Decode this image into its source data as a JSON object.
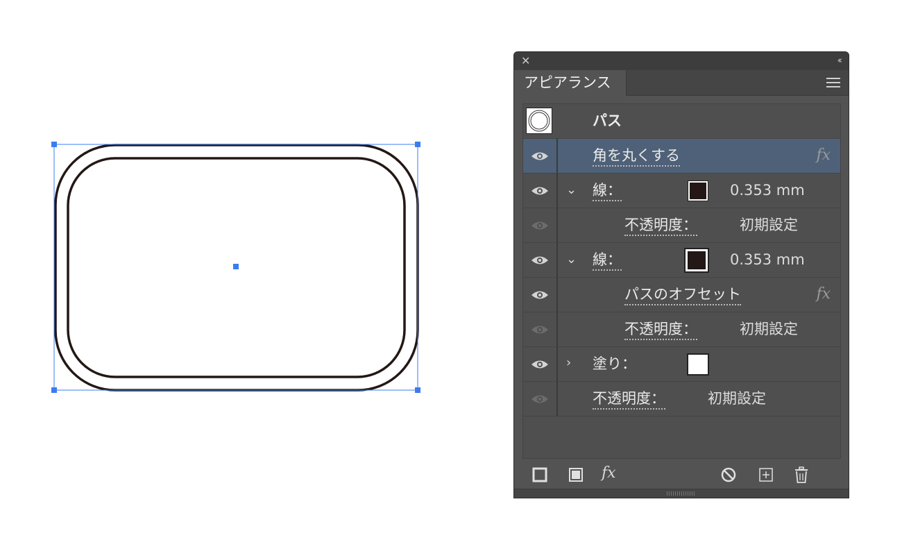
{
  "panel": {
    "title": "アピアランス",
    "object_name": "パス",
    "rows": [
      {
        "label": "角を丸くする",
        "fx": "fx",
        "visible": true,
        "selected": true
      },
      {
        "label": "線：",
        "value": "0.353 mm",
        "swatch": "stroke-dark",
        "visible": true,
        "expanded": true
      },
      {
        "label": "不透明度：",
        "value": "初期設定",
        "visible": false
      },
      {
        "label": "線：",
        "value": "0.353 mm",
        "swatch": "stroke-double",
        "visible": true,
        "expanded": true
      },
      {
        "label": "パスのオフセット",
        "fx": "fx",
        "visible": true
      },
      {
        "label": "不透明度：",
        "value": "初期設定",
        "visible": false
      },
      {
        "label": "塗り：",
        "swatch": "fill-white",
        "visible": true,
        "expanded": false
      },
      {
        "label": "不透明度：",
        "value": "初期設定",
        "visible": false
      }
    ],
    "bottom_buttons": [
      "add-stroke-icon",
      "add-fill-icon",
      "fx-menu-icon",
      "clear-appearance-icon",
      "duplicate-item-icon",
      "delete-item-icon"
    ],
    "fx_button_label": "fx"
  },
  "colors": {
    "selection": "#3b7cf0",
    "stroke": "#231815",
    "panel_bg": "#535353",
    "selected_row": "#4e6178"
  }
}
